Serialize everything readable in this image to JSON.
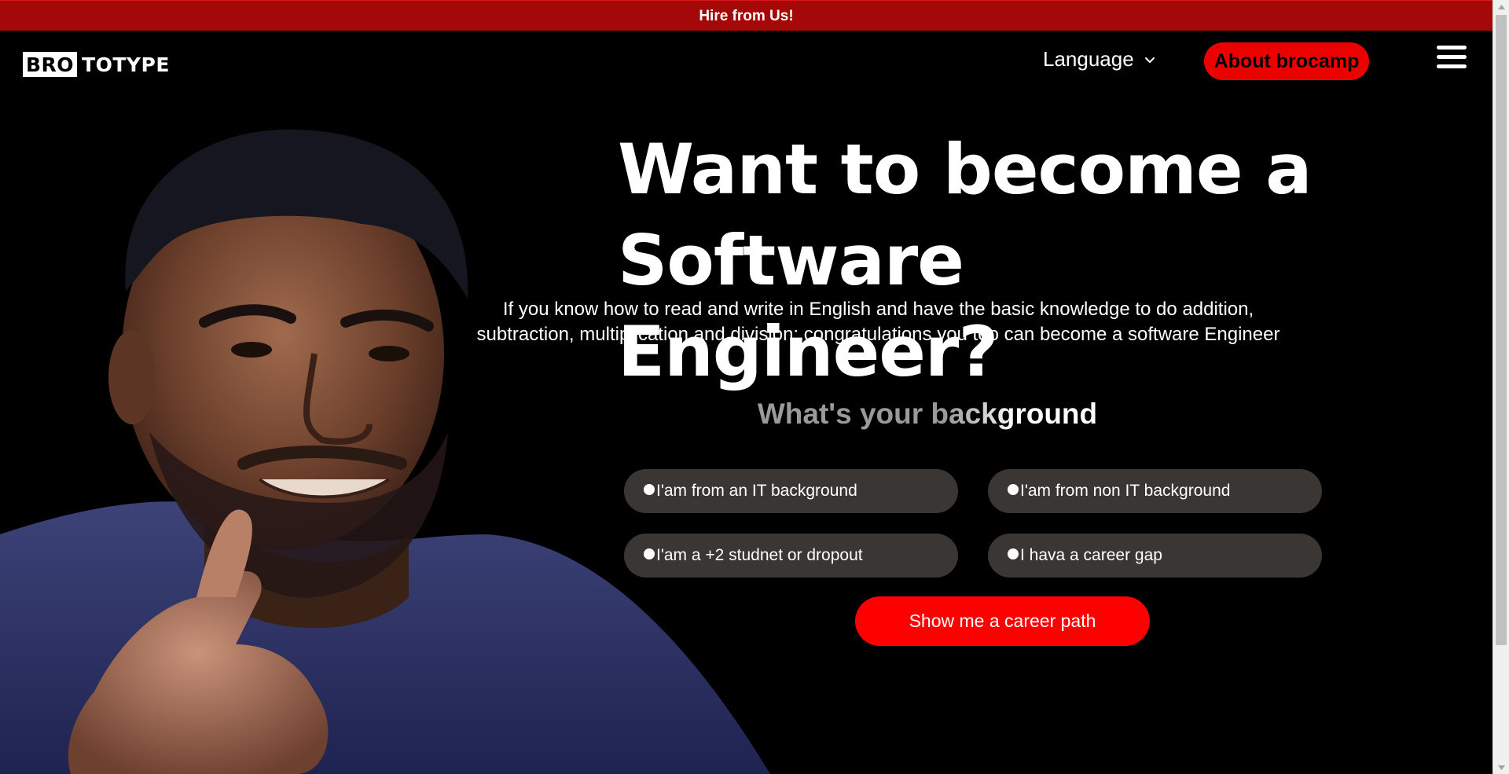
{
  "banner": {
    "text": "Hire from Us!"
  },
  "header": {
    "logo_box": "BRO",
    "logo_rest": "TOTYPE",
    "language_label": "Language",
    "about_label": "About brocamp"
  },
  "hero": {
    "headline_line1": "Want to become a",
    "headline_line2": "Software Engineer?",
    "subtext": "If you know how to read and write in English and have the basic knowledge to do addition, subtraction, multiplication and division; congratulations you too can become a software Engineer",
    "question": "What's your background",
    "options": [
      {
        "label": "I'am from an IT background"
      },
      {
        "label": "I'am from non IT background"
      },
      {
        "label": "I'am a +2 studnet or dropout"
      },
      {
        "label": "I hava a career gap"
      }
    ],
    "cta_label": "Show me a career path"
  },
  "colors": {
    "banner": "#a40808",
    "accent_red": "#ec0000",
    "cta_red": "#ff0000",
    "option_bg": "#3a3634"
  },
  "icons": {
    "language_chevron": "chevron-down-icon",
    "menu": "hamburger-menu-icon"
  }
}
